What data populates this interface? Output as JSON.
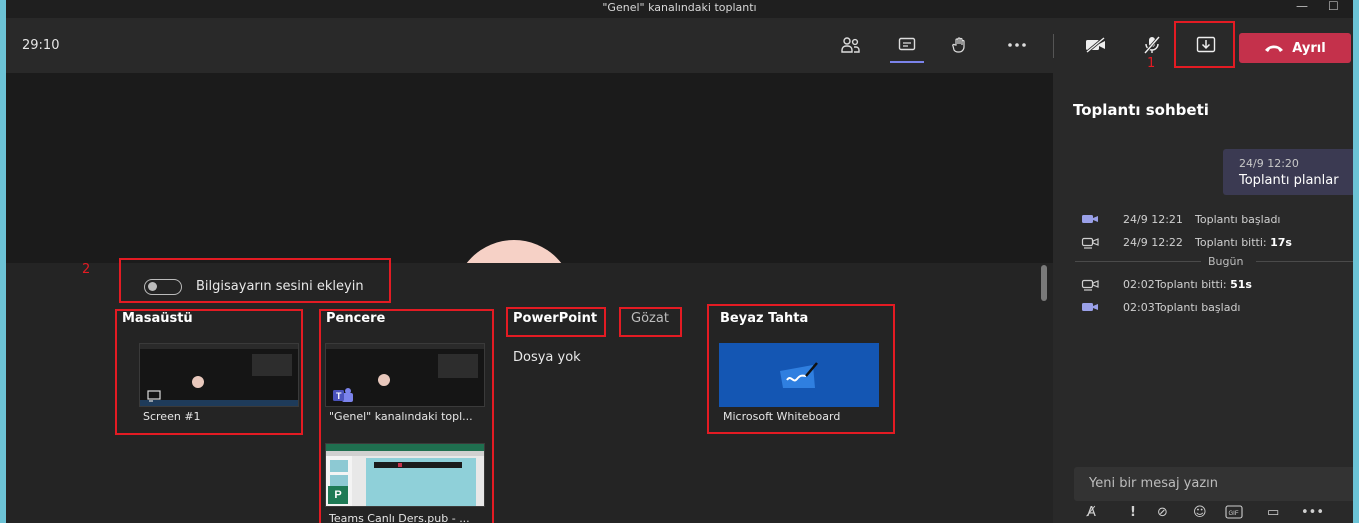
{
  "window": {
    "title": "\"Genel\" kanalındaki toplantı"
  },
  "topbar": {
    "timer": "29:10",
    "icons": [
      "participants-icon",
      "chat-icon",
      "raise-hand-icon",
      "more-icon",
      "camera-off-icon",
      "mic-off-icon",
      "share-tray-icon",
      "hang-up-icon"
    ],
    "leave_label": "Ayrıl"
  },
  "annotations": {
    "step1": "1",
    "step2": "2",
    "highlight_color": "#e31b23"
  },
  "share_tray": {
    "audio_toggle_label": "Bilgisayarın sesini ekleyin",
    "desktop": {
      "heading": "Masaüstü",
      "screens": [
        {
          "caption": "Screen #1"
        }
      ]
    },
    "window": {
      "heading": "Pencere",
      "windows": [
        {
          "caption": "\"Genel\" kanalındaki topl..."
        },
        {
          "caption": "Teams Canlı Ders.pub - ..."
        }
      ]
    },
    "powerpoint": {
      "heading": "PowerPoint",
      "browse_label": "Gözat",
      "empty_text": "Dosya yok"
    },
    "whiteboard": {
      "heading": "Beyaz Tahta",
      "caption": "Microsoft Whiteboard"
    }
  },
  "chat": {
    "title": "Toplantı sohbeti",
    "message": {
      "time": "24/9 12:20",
      "text": "Toplantı planlar"
    },
    "events": [
      {
        "time": "24/9 12:21",
        "text": "Toplantı başladı",
        "bold": ""
      },
      {
        "time": "24/9 12:22",
        "text": "Toplantı bitti: ",
        "bold": "17s"
      },
      {
        "time": "02:02",
        "text": "Toplantı bitti: ",
        "bold": "51s"
      },
      {
        "time": "02:03",
        "text": "Toplantı başladı",
        "bold": ""
      }
    ],
    "today_label": "Bugün",
    "compose_placeholder": "Yeni bir mesaj yazın",
    "compose_icons": [
      "format-icon",
      "important-icon",
      "attach-icon",
      "emoji-icon",
      "gif-icon",
      "sticker-icon",
      "more-icon"
    ]
  },
  "colors": {
    "accent": "#7b83eb",
    "leave": "#c4314b",
    "whiteboard_tile": "#1456b3"
  }
}
